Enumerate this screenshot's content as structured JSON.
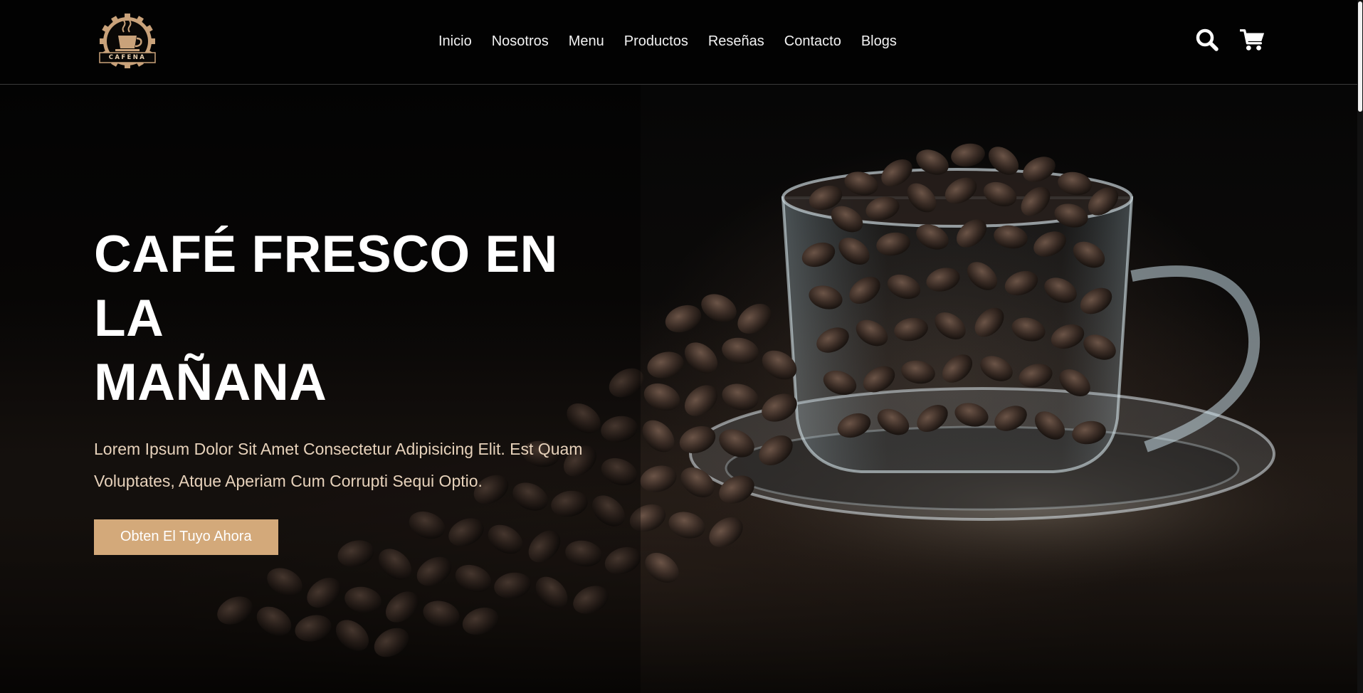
{
  "brand": {
    "name": "CAFENA",
    "accent_color": "#d3a97a"
  },
  "nav": {
    "items": [
      "Inicio",
      "Nosotros",
      "Menu",
      "Productos",
      "Reseñas",
      "Contacto",
      "Blogs"
    ]
  },
  "header_icons": {
    "search": "search-icon",
    "cart": "shopping-cart-icon"
  },
  "hero": {
    "title_line1": "CAFÉ FRESCO EN LA",
    "title_line2": "MAÑANA",
    "subtitle": "Lorem Ipsum Dolor Sit Amet Consectetur Adipisicing Elit. Est Quam Voluptates, Atque Aperiam Cum Corrupti Sequi Optio.",
    "cta_label": "Obten El Tuyo Ahora"
  }
}
